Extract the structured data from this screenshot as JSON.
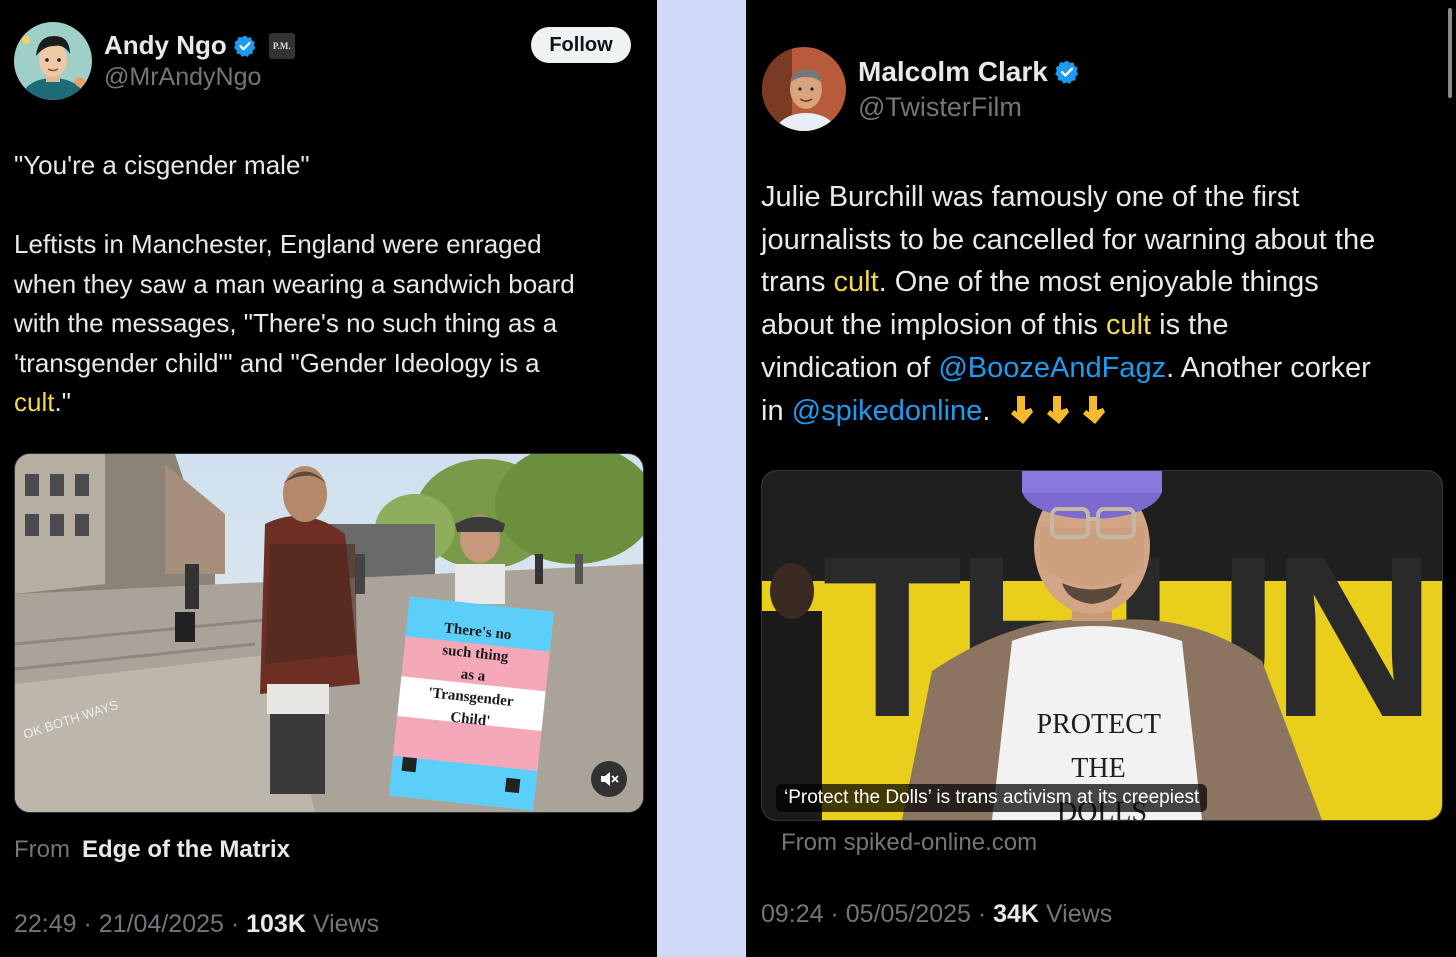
{
  "colors": {
    "divider": "#cfd9f8",
    "accent_link": "#1d9bf0",
    "highlight": "#f0d84a",
    "muted": "#71767b",
    "text": "#e7e9ea"
  },
  "left_tweet": {
    "author_name": "Andy Ngo",
    "handle": "@MrAndyNgo",
    "affiliate_badge": "P.M.",
    "follow_label": "Follow",
    "text_line1": "\"You're a cisgender male\"",
    "text_body_1": "Leftists in Manchester, England were enraged\nwhen they saw a man wearing a sandwich board\nwith the messages, \"There's no such thing as a\n'transgender child'\" and \"Gender Ideology is a\n",
    "text_highlight": "cult",
    "text_body_2": ".\"",
    "media": {
      "sign_text": "There's no\nsuch thing\nas a\n'Transgender\nChild'",
      "ground_text": "OK BOTH WAYS"
    },
    "from_label": "From",
    "from_source": "Edge of the Matrix",
    "time": "22:49",
    "date": "21/04/2025",
    "views_count": "103K",
    "views_label": "Views"
  },
  "right_tweet": {
    "author_name": "Malcolm Clark",
    "handle": "@TwisterFilm",
    "text_a": "Julie Burchill was famously one of the first\njournalists to be cancelled for warning about the\ntrans ",
    "text_hl1": "cult",
    "text_b": ". One of the most enjoyable things\nabout the implosion of this ",
    "text_hl2": "cult",
    "text_c": " is the\nvindication of ",
    "mention1": "@BoozeAndFagz",
    "text_d": ". Another corker\nin ",
    "mention2": "@spikedonline",
    "text_e": ".",
    "emoji_count_note": "👇👇👇",
    "media": {
      "backdrop_text": "THUNDERBO",
      "shirt_text": "PROTECT\nTHE\nDOLLS",
      "caption": "‘Protect the Dolls’ is trans activism at its creepiest"
    },
    "from_text": "From spiked-online.com",
    "time": "09:24",
    "date": "05/05/2025",
    "views_count": "34K",
    "views_label": "Views"
  }
}
